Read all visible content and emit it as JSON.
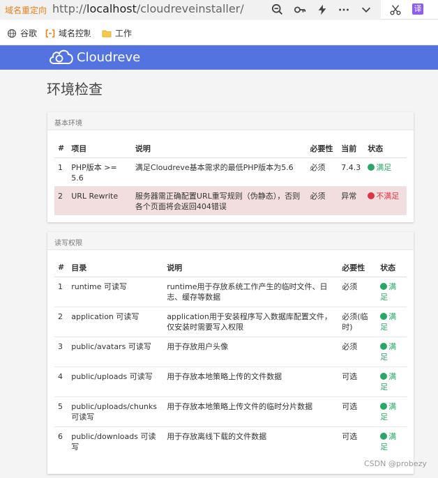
{
  "browser": {
    "redirect_label": "域名重定向",
    "url_scheme": "http://",
    "url_host": "localhost",
    "url_path": "/cloudreveinstaller/",
    "translate_badge": "译",
    "bookmarks": [
      {
        "icon": "globe-icon",
        "label": "谷歌"
      },
      {
        "icon": "bracket-icon",
        "label": "域名控制"
      },
      {
        "icon": "folder-icon",
        "label": "工作"
      }
    ]
  },
  "app": {
    "logo_text": "Cloudreve",
    "page_title": "环境检查",
    "colors": {
      "header": "#5273e0",
      "ok": "#28a766",
      "bad": "#dc3545",
      "danger_row": "#f2dede"
    }
  },
  "basic": {
    "title": "基本环境",
    "headers": [
      "#",
      "项目",
      "说明",
      "必要性",
      "当前",
      "状态"
    ],
    "rows": [
      {
        "n": "1",
        "item": "PHP版本 >= 5.6",
        "desc": "满足Cloudreve基本需求的最低PHP版本为5.6",
        "req": "必须",
        "cur": "7.4.3",
        "status": "满足",
        "ok": true
      },
      {
        "n": "2",
        "item": "URL Rewrite",
        "desc": "服务器需正确配置URL重写规则（伪静态），否则各个页面将会返回404错误",
        "req": "必须",
        "cur": "异常",
        "status": "不满足",
        "ok": false
      }
    ]
  },
  "perm": {
    "title": "读写权限",
    "headers": [
      "#",
      "目录",
      "说明",
      "必要性",
      "状态"
    ],
    "rows": [
      {
        "n": "1",
        "dir": "runtime 可读写",
        "desc": "runtime用于存放系统工作产生的临时文件、日志、缓存等数据",
        "req": "必须",
        "status": "满足"
      },
      {
        "n": "2",
        "dir": "application 可读写",
        "desc": "application用于安装程序写入数据库配置文件，仅安装时需要写入权限",
        "req": "必须(临时)",
        "status": "满足"
      },
      {
        "n": "3",
        "dir": "public/avatars 可读写",
        "desc": "用于存放用户头像",
        "req": "必须",
        "status": "满足"
      },
      {
        "n": "4",
        "dir": "public/uploads 可读写",
        "desc": "用于存放本地策略上传的文件数据",
        "req": "可选",
        "status": "满足"
      },
      {
        "n": "5",
        "dir": "public/uploads/chunks 可读写",
        "desc": "用于存放本地策略上传文件的临时分片数据",
        "req": "可选",
        "status": "满足"
      },
      {
        "n": "6",
        "dir": "public/downloads 可读写",
        "desc": "用于存放离线下载的文件数据",
        "req": "可选",
        "status": "满足"
      }
    ]
  },
  "watermark": "CSDN @probezy"
}
